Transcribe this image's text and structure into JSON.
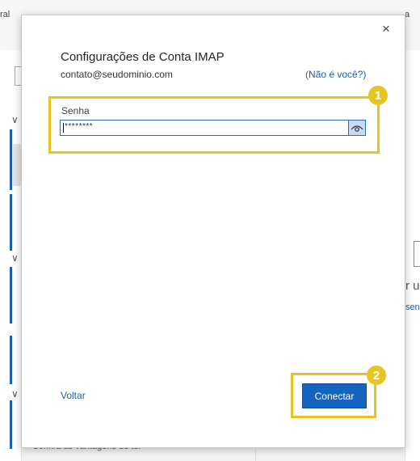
{
  "background": {
    "ribbon_left_fragment": "ral",
    "ribbon_right_fragment": "a",
    "right_panel_fragment_1": "r u",
    "right_panel_fragment_2": "sen",
    "bottom_left_text": "Confira as vantagens de ter"
  },
  "dialog": {
    "title": "Configurações de Conta IMAP",
    "email": "contato@seudominio.com",
    "not_you_link": "(Não é você?)",
    "password_label": "Senha",
    "password_value": "********",
    "back_link": "Voltar",
    "connect_button": "Conectar",
    "close_glyph": "×"
  },
  "annotations": {
    "badge_1": "1",
    "badge_2": "2",
    "highlight_color": "#e8c423"
  },
  "colors": {
    "accent_blue": "#1565c0",
    "link_blue": "#1f5fa6"
  },
  "icons": {
    "close": "close-icon",
    "show_password": "eye-icon",
    "envelope": "envelope-icon",
    "chevron": "chevron-down-icon"
  }
}
